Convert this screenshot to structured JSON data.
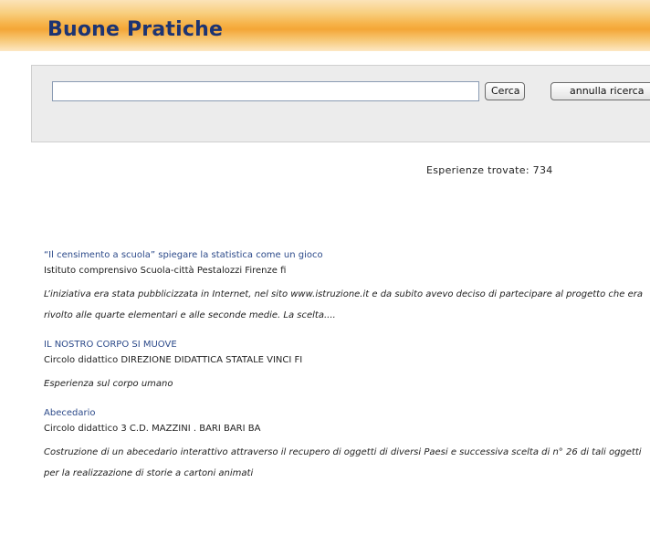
{
  "header": {
    "title": "Buone Pratiche"
  },
  "search": {
    "value": "",
    "placeholder": "",
    "search_button": "Cerca",
    "cancel_button": "annulla ricerca"
  },
  "results": {
    "count_text": "Esperienze trovate: 734",
    "items": [
      {
        "title": "“Il censimento a scuola” spiegare la statistica come un gioco",
        "org": "Istituto comprensivo Scuola-città Pestalozzi Firenze fi",
        "desc": "L’iniziativa era stata pubblicizzata in Internet, nel sito www.istruzione.it e da subito avevo deciso di partecipare al progetto che era rivolto alle quarte elementari e alle seconde medie. La scelta...."
      },
      {
        "title": "IL NOSTRO CORPO SI MUOVE",
        "org": "Circolo didattico DIREZIONE DIDATTICA STATALE VINCI FI",
        "desc": "Esperienza sul corpo umano"
      },
      {
        "title": "Abecedario",
        "org": "Circolo didattico 3 C.D. MAZZINI . BARI BARI BA",
        "desc": "Costruzione di un abecedario interattivo attraverso il recupero di oggetti di diversi Paesi e successiva scelta di n° 26 di tali oggetti per la realizzazione di storie a cartoni animati"
      }
    ]
  }
}
